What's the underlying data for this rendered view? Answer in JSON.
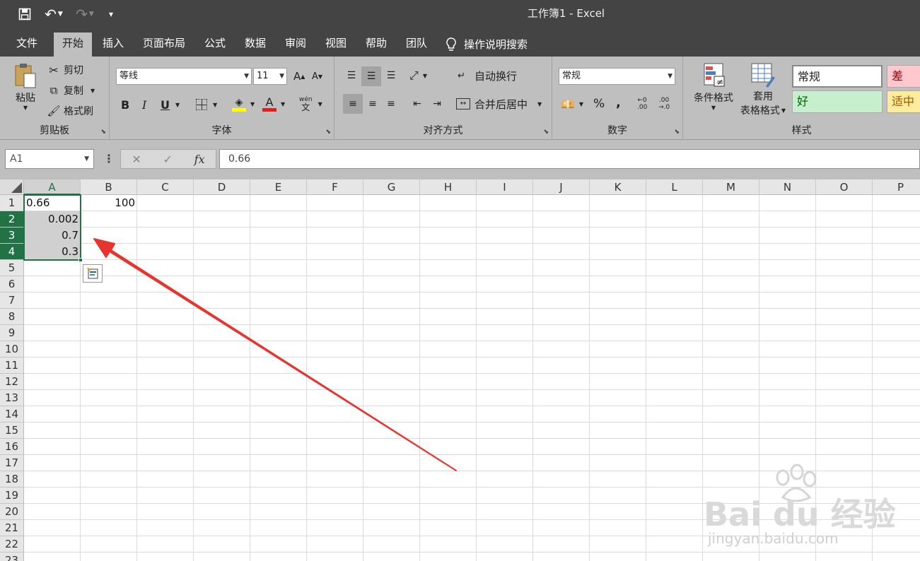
{
  "window": {
    "title": "工作簿1  -  Excel"
  },
  "quick_access": {
    "save": "🖫",
    "undo": "↶",
    "redo": "↷",
    "customize": "▾"
  },
  "tabs": [
    "文件",
    "开始",
    "插入",
    "页面布局",
    "公式",
    "数据",
    "审阅",
    "视图",
    "帮助",
    "团队"
  ],
  "tell_me": "操作说明搜索",
  "ribbon": {
    "clipboard": {
      "label": "剪贴板",
      "paste": "粘贴",
      "cut": "剪切",
      "copy": "复制",
      "format_painter": "格式刷"
    },
    "font": {
      "label": "字体",
      "font_name": "等线",
      "font_size": "11",
      "grow": "A",
      "shrink": "A",
      "bold": "B",
      "italic": "I",
      "underline": "U",
      "font_color_letter": "A",
      "phonetic_top": "wén",
      "phonetic_bottom": "文"
    },
    "alignment": {
      "label": "对齐方式",
      "wrap_text": "自动换行",
      "merge_center": "合并后居中"
    },
    "number": {
      "label": "数字",
      "format": "常规",
      "percent": "%",
      "comma": ",",
      "inc_decimal": "←0\n.00",
      "dec_decimal": ".00\n→.0"
    },
    "styles": {
      "label": "样式",
      "conditional": "条件格式",
      "table_format_1": "套用",
      "table_format_2": "表格格式",
      "normal": "常规",
      "bad": "差",
      "good": "好",
      "neutral": "适中"
    }
  },
  "formula_bar": {
    "name_box": "A1",
    "cancel": "✕",
    "enter": "✓",
    "fx": "fx",
    "formula": "0.66"
  },
  "columns": [
    "A",
    "B",
    "C",
    "D",
    "E",
    "F",
    "G",
    "H",
    "I",
    "J",
    "K",
    "L",
    "M",
    "N",
    "O",
    "P"
  ],
  "rows": [
    "1",
    "2",
    "3",
    "4",
    "5",
    "6",
    "7",
    "8",
    "9",
    "10",
    "11",
    "12",
    "13",
    "14",
    "15",
    "16",
    "17",
    "18",
    "19",
    "20",
    "21",
    "22",
    "23"
  ],
  "cells": {
    "A1": "0.66",
    "B1": "100",
    "A2": "0.002",
    "A3": "0.7",
    "A4": "0.3"
  },
  "watermark": {
    "brand": "Bai du 经验",
    "url": "jingyan.baidu.com"
  },
  "colors": {
    "accent": "#217346",
    "annotation_arrow": "#e8342e"
  }
}
